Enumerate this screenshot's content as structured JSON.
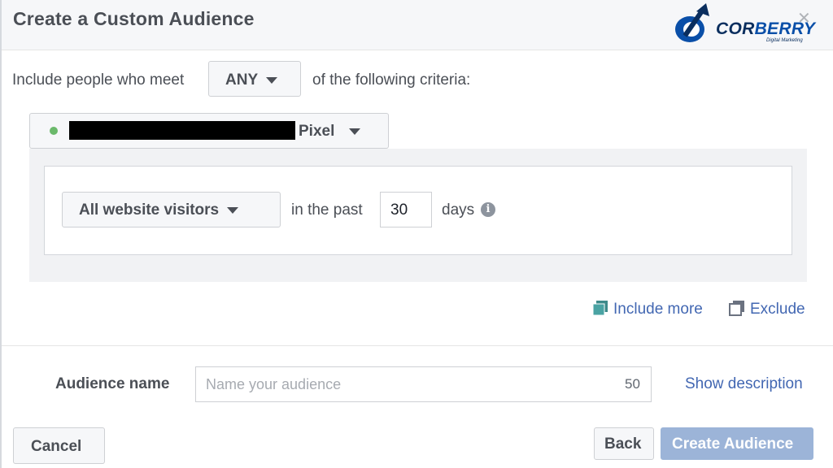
{
  "dialog": {
    "title": "Create a Custom Audience",
    "close_icon": "close-icon"
  },
  "logo": {
    "brand_main": "COR",
    "brand_accent": "BERRY",
    "tagline": "Digital Marketing"
  },
  "criteria": {
    "prefix": "Include people who meet",
    "match_value": "ANY",
    "suffix": "of the following criteria:"
  },
  "source": {
    "status_color": "#6bb96b",
    "label": "Pixel"
  },
  "rule": {
    "visitors_value": "All website visitors",
    "in_the_past": "in the past",
    "days_value": "30",
    "days_label": "days",
    "info_glyph": "i"
  },
  "actions": {
    "include_more": "Include more",
    "exclude": "Exclude"
  },
  "audience": {
    "label": "Audience name",
    "placeholder": "Name your audience",
    "char_count": "50",
    "show_description": "Show description"
  },
  "footer": {
    "cancel": "Cancel",
    "back": "Back",
    "create": "Create Audience"
  },
  "colors": {
    "link": "#4267b2",
    "primary_disabled": "#9cb4d8",
    "brand_blue": "#0a4fa8"
  }
}
